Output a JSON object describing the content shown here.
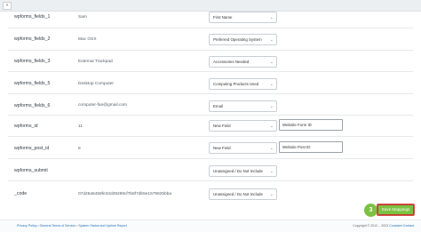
{
  "toolbar": {
    "collapse_glyph": "»"
  },
  "mappings": [
    {
      "field": "wpforms_fields_1",
      "value": "Sam",
      "select": "First Name"
    },
    {
      "field": "wpforms_fields_2",
      "value": "Mac OSX",
      "select": "Preferred Operating System"
    },
    {
      "field": "wpforms_fields_3",
      "value": "External Trackpad",
      "select": "Accessories Needed"
    },
    {
      "field": "wpforms_fields_5",
      "value": "Desktop Computer",
      "select": "Computing Products Used"
    },
    {
      "field": "wpforms_fields_6",
      "value": "computer-fan@gmail.com",
      "select": "Email"
    },
    {
      "field": "wpforms_id",
      "value": "11",
      "select": "New Field",
      "input": "Website Form ID"
    },
    {
      "field": "wpforms_post_id",
      "value": "8",
      "select": "New Field",
      "input": "Website Post ID"
    },
    {
      "field": "wpforms_submit",
      "value": "",
      "select": "Unassigned / Do Not Include"
    },
    {
      "field": "_code",
      "value": "07d25a5459fe32d39299cf7b8f7db5e1579625bba",
      "select": "Unassigned / Do Not Include"
    }
  ],
  "actions": {
    "step_number": "3",
    "save_label": "Save Mappings"
  },
  "footer": {
    "links": [
      "Privacy Policy",
      "General Terms of Service",
      "System Status and Uptime Report"
    ],
    "separator": "•",
    "copyright": "Copyright © 2012 – 2023",
    "brand": "Constant Contact"
  },
  "colors": {
    "accent": "#7cc142",
    "highlight_border": "#c0392b",
    "link": "#1f73b7"
  }
}
